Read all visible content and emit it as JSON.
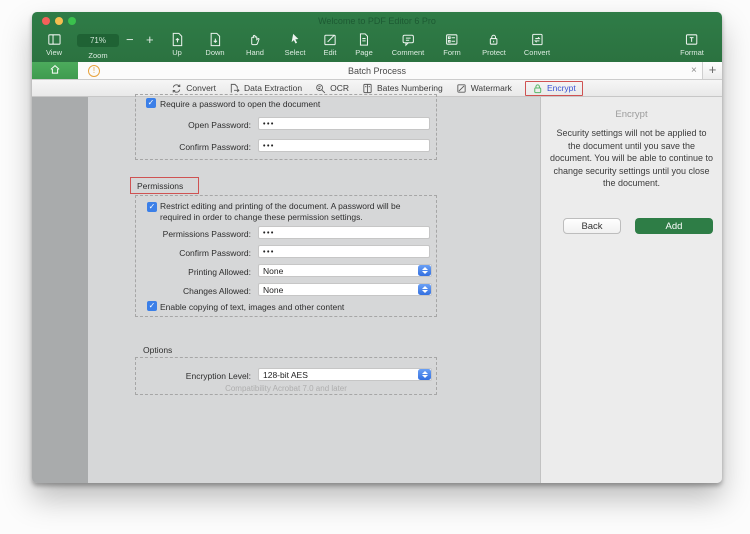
{
  "window": {
    "title": "Welcome to PDF Editor 6 Pro"
  },
  "toolbar": {
    "zoom_value": "71%",
    "minus": "−",
    "plus": "+",
    "labels": {
      "view": "View",
      "zoom": "Zoom",
      "up": "Up",
      "down": "Down",
      "hand": "Hand",
      "select": "Select",
      "edit": "Edit",
      "page": "Page",
      "comment": "Comment",
      "form": "Form",
      "protect": "Protect",
      "convert": "Convert",
      "format": "Format"
    }
  },
  "tabbar": {
    "alert": "!",
    "title": "Batch Process",
    "close": "×",
    "new_tab": "+"
  },
  "subtoolbar": {
    "items": [
      "Convert",
      "Data Extraction",
      "OCR",
      "Bates Numbering",
      "Watermark",
      "Encrypt"
    ]
  },
  "form": {
    "check_glyph": "✓",
    "open_checkbox": "Require a password to open the document",
    "open_password_label": "Open Password:",
    "open_password_value": "•••",
    "confirm_password_label": "Confirm Password:",
    "confirm_password_value": "•••",
    "permissions_title": "Permissions",
    "restrict_checkbox": "Restrict editing and printing of the document. A password will be required in order to change these permission settings.",
    "permissions_password_label": "Permissions Password:",
    "permissions_password_value": "•••",
    "confirm2_label": "Confirm Password:",
    "confirm2_value": "•••",
    "printing_label": "Printing Allowed:",
    "printing_value": "None",
    "changes_label": "Changes Allowed:",
    "changes_value": "None",
    "copy_checkbox": "Enable copying of text, images and other content",
    "options_title": "Options",
    "encryption_label": "Encryption Level:",
    "encryption_value": "128-bit AES",
    "compatibility_note": "Compatibility Acrobat 7.0 and later"
  },
  "panel": {
    "title": "Encrypt",
    "description": "Security settings will not be applied to the document until you save the document. You will be able to continue to change security settings until you close the document.",
    "back": "Back",
    "add": "Add"
  },
  "colors": {
    "brand_green": "#2e7b45",
    "home_green": "#45a455",
    "accent_blue": "#3b7fe8",
    "annotation_red": "#cf5252",
    "encrypt_text_blue": "#3a52d4"
  }
}
